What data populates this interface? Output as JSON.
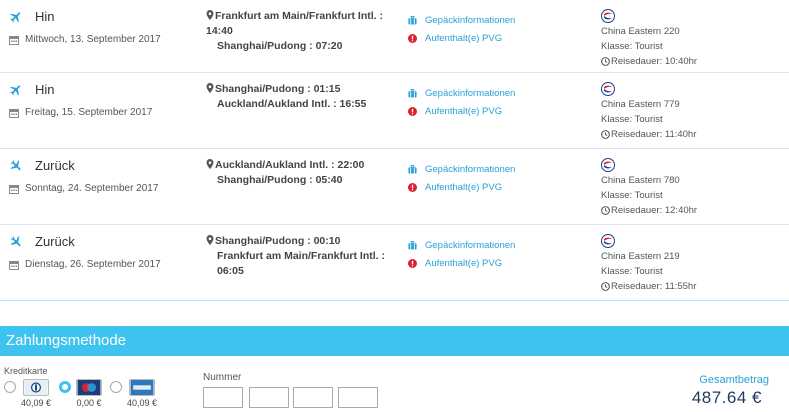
{
  "flights": [
    {
      "direction": "Hin",
      "date": "Mittwoch, 13. September 2017",
      "route_from": "Frankfurt am Main/Frankfurt Intl. : 14:40",
      "route_to": "Shanghai/Pudong : 07:20",
      "baggage": "Gepäckinformationen",
      "stopover": "Aufenthalt(e) PVG",
      "airline": "China Eastern 220",
      "class": "Klasse: Tourist",
      "duration": "Reisedauer: 10:40hr"
    },
    {
      "direction": "Hin",
      "date": "Freitag, 15. September 2017",
      "route_from": "Shanghai/Pudong : 01:15",
      "route_to": "Auckland/Aukland Intl. : 16:55",
      "baggage": "Gepäckinformationen",
      "stopover": "Aufenthalt(e) PVG",
      "airline": "China Eastern 779",
      "class": "Klasse: Tourist",
      "duration": "Reisedauer: 11:40hr"
    },
    {
      "direction": "Zurück",
      "date": "Sonntag, 24. September 2017",
      "route_from": "Auckland/Aukland Intl. : 22:00",
      "route_to": "Shanghai/Pudong : 05:40",
      "baggage": "Gepäckinformationen",
      "stopover": "Aufenthalt(e) PVG",
      "airline": "China Eastern 780",
      "class": "Klasse: Tourist",
      "duration": "Reisedauer: 12:40hr"
    },
    {
      "direction": "Zurück",
      "date": "Dienstag, 26. September 2017",
      "route_from": "Shanghai/Pudong : 00:10",
      "route_to": "Frankfurt am Main/Frankfurt Intl. : 06:05",
      "baggage": "Gepäckinformationen",
      "stopover": "Aufenthalt(e) PVG",
      "airline": "China Eastern 219",
      "class": "Klasse: Tourist",
      "duration": "Reisedauer: 11:55hr"
    }
  ],
  "payment": {
    "header": "Zahlungsmethode",
    "kreditkarte_label": "Kreditkarte",
    "cards": [
      {
        "name": "Diners Club",
        "price": "40,09 €",
        "selected": false,
        "icon": "diners-card-icon"
      },
      {
        "name": "Maestro",
        "price": "0,00 €",
        "selected": true,
        "icon": "maestro-card-icon"
      },
      {
        "name": "American Express",
        "price": "40,09 €",
        "selected": false,
        "icon": "amex-card-icon"
      }
    ],
    "nummer_label": "Nummer",
    "total_label": "Gesamtbetrag",
    "total_value": "487.64 €"
  },
  "colors": {
    "accent": "#2a9fd8",
    "header_bg": "#3ec3f0",
    "total_text": "#1d3a5f",
    "warning_red": "#d9232e"
  }
}
